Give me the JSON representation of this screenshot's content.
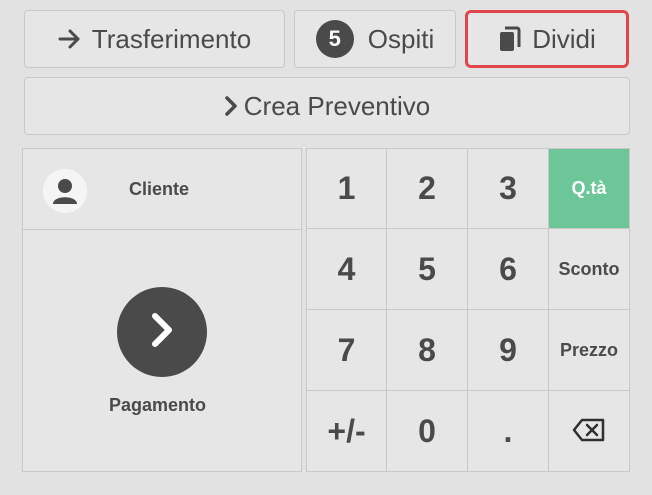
{
  "header": {
    "transfer_label": "Trasferimento",
    "guests_count": "5",
    "guests_label": "Ospiti",
    "split_label": "Dividi",
    "quote_label": "Crea Preventivo"
  },
  "left_panel": {
    "client_label": "Cliente",
    "payment_label": "Pagamento"
  },
  "keypad": {
    "keys": [
      "1",
      "2",
      "3",
      "Q.tà",
      "4",
      "5",
      "6",
      "Sconto",
      "7",
      "8",
      "9",
      "Prezzo",
      "+/-",
      "0",
      "."
    ],
    "active_key": "Q.tà"
  },
  "colors": {
    "active_green": "#6dc698",
    "highlight_red": "#e0454a",
    "dark": "#4a4a4a"
  },
  "icons": [
    "arrow-right-icon",
    "copy-icon",
    "chevron-right-icon",
    "person-icon",
    "backspace-icon"
  ]
}
